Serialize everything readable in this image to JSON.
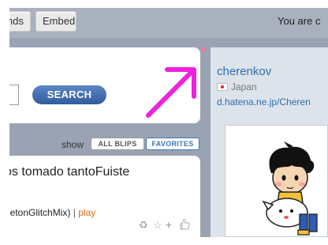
{
  "topbar": {
    "tab_friends_label": "nds",
    "tab_embed_label": "Embed",
    "account_text": "You are c"
  },
  "search": {
    "button_label": "SEARCH",
    "input_value": ""
  },
  "filter": {
    "show_label": "show",
    "all_blips_label": "ALL BLIPS",
    "favorites_label": "FAVORITES"
  },
  "blip": {
    "text": "os tomado tantoFuiste",
    "source": "getonGlitchMix)",
    "separator": "|",
    "play_label": "play",
    "actions": [
      "recycle-icon",
      "star-icon",
      "plus-icon",
      "thumbs-up-icon"
    ]
  },
  "profile": {
    "username": "cherenkov",
    "location": "Japan",
    "homepage": "d.hatena.ne.jp/Cheren"
  },
  "colors": {
    "accent_link": "#2c6fb3",
    "arrow": "#ee22dd",
    "play": "#e06a12",
    "search_button": "#3a68aa"
  }
}
